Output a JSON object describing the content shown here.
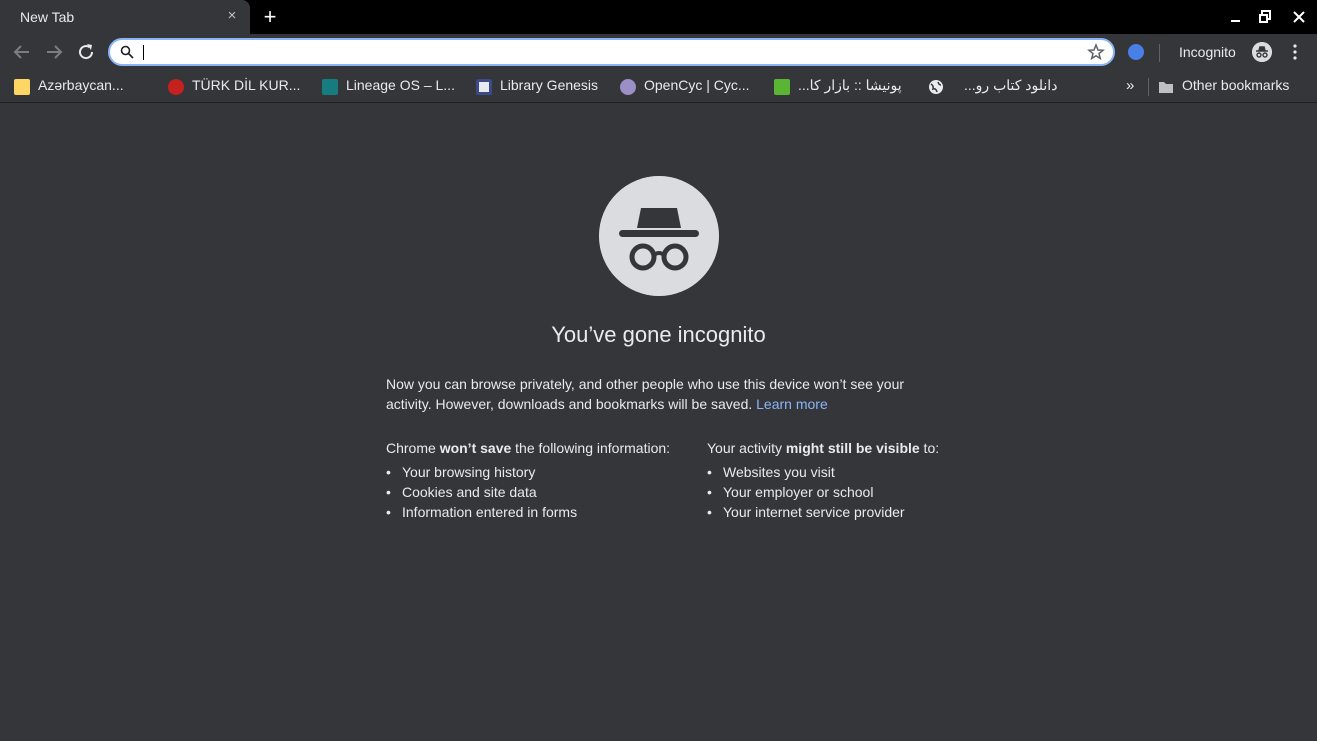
{
  "tab": {
    "title": "New Tab",
    "close": "×"
  },
  "window_controls": {
    "newtab": "+"
  },
  "toolbar": {
    "omnibox_value": "",
    "profile_label": "Incognito"
  },
  "bookmarks": [
    {
      "label": "Azərbaycan...",
      "color": "#fdd663"
    },
    {
      "label": "TÜRK DİL KUR...",
      "color": "#c5221f"
    },
    {
      "label": "Lineage OS – L...",
      "color": "#167c80"
    },
    {
      "label": "Library Genesis",
      "color": "#e8eaed"
    },
    {
      "label": "OpenCyc | Cyc...",
      "color": "#9c8fc6"
    },
    {
      "label": "پونیشا :: بازار کا...",
      "color": "#5bb534"
    },
    {
      "label": "دانلود کتاب رو...",
      "color": "#e8eaed"
    }
  ],
  "bookmarks_overflow": "»",
  "other_bookmarks": "Other bookmarks",
  "main": {
    "heading": "You’ve gone incognito",
    "intro": "Now you can browse privately, and other people who use this device won’t see your activity. However, downloads and bookmarks will be saved.",
    "learn_more": "Learn more",
    "left_head_pre": "Chrome ",
    "left_head_bold": "won’t save",
    "left_head_post": " the following information:",
    "left_items": [
      "Your browsing history",
      "Cookies and site data",
      "Information entered in forms"
    ],
    "right_head_pre": "Your activity ",
    "right_head_bold": "might still be visible",
    "right_head_post": " to:",
    "right_items": [
      "Websites you visit",
      "Your employer or school",
      "Your internet service provider"
    ]
  }
}
